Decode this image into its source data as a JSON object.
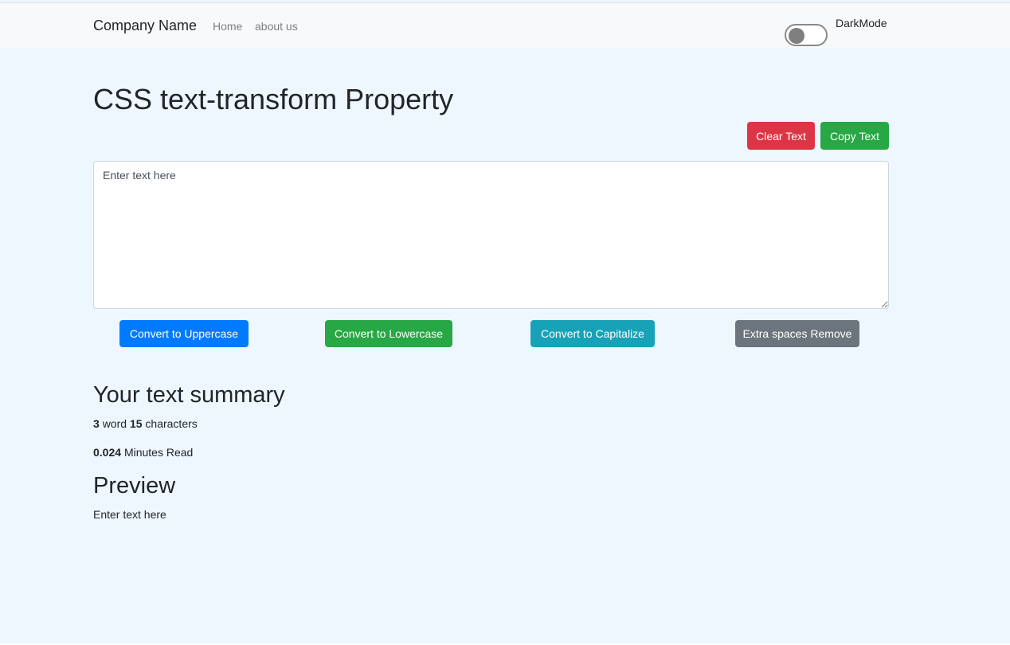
{
  "navbar": {
    "brand": "Company Name",
    "links": [
      {
        "label": "Home"
      },
      {
        "label": "about us"
      }
    ],
    "darkmode_label": "DarkMode",
    "darkmode_on": false
  },
  "main": {
    "title": "CSS text-transform Property",
    "clear_button": "Clear Text",
    "copy_button": "Copy Text",
    "textarea_placeholder": "Enter text here",
    "textarea_value": "",
    "convert_buttons": [
      {
        "label": "Convert to Uppercase",
        "color": "#007bff"
      },
      {
        "label": "Convert to Lowercase",
        "color": "#28a745"
      },
      {
        "label": "Convert to Capitalize",
        "color": "#17a2b8"
      },
      {
        "label": "Extra spaces Remove",
        "color": "#6c757d"
      }
    ]
  },
  "summary": {
    "title": "Your text summary",
    "word_count": "3",
    "word_label": "word",
    "char_count": "15",
    "char_label": "characters",
    "minutes": "0.024",
    "minutes_label": "Minutes Read"
  },
  "preview": {
    "title": "Preview",
    "text": "Enter text here"
  },
  "colors": {
    "background": "#eef7ff",
    "navbar": "#f8f9fa",
    "danger": "#dc3545",
    "success": "#28a745"
  }
}
